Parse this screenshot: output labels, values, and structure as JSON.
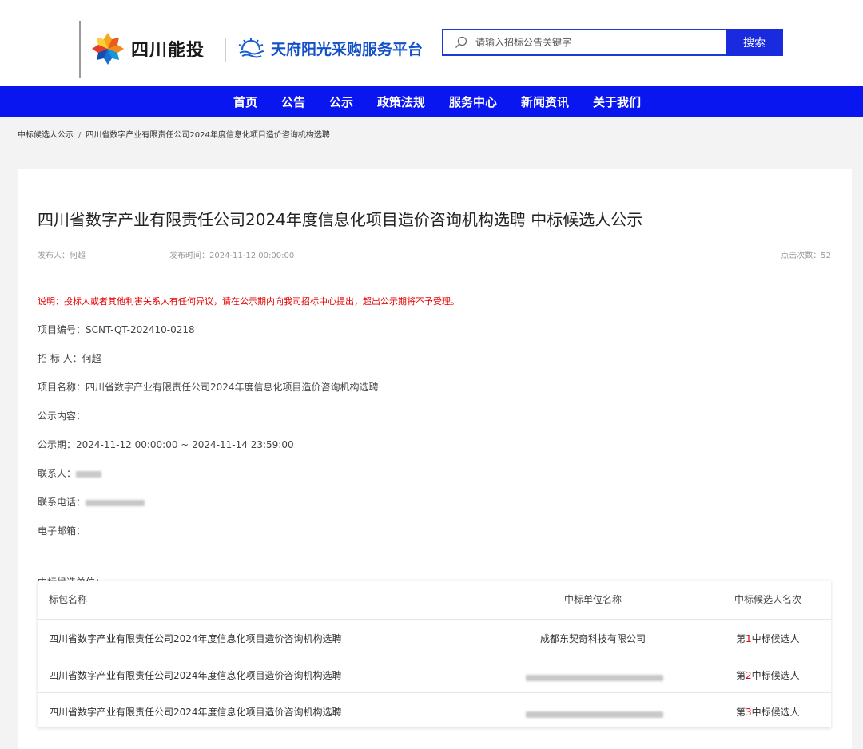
{
  "header": {
    "brand1": "四川能投",
    "brand2": "天府阳光采购服务平台",
    "search_placeholder": "请输入招标公告关键字",
    "search_button": "搜索"
  },
  "nav": [
    "首页",
    "公告",
    "公示",
    "政策法规",
    "服务中心",
    "新闻资讯",
    "关于我们"
  ],
  "breadcrumb": {
    "parent": "中标候选人公示",
    "separator": "/",
    "current": "四川省数字产业有限责任公司2024年度信息化项目造价咨询机构选聘"
  },
  "article": {
    "title": "四川省数字产业有限责任公司2024年度信息化项目造价咨询机构选聘 中标候选人公示",
    "publisher_label": "发布人：",
    "publisher": "何超",
    "publish_time_label": "发布时间：",
    "publish_time": "2024-11-12 00:00:00",
    "clicks_label": "点击次数：",
    "clicks": "52",
    "notice": "说明：投标人或者其他利害关系人有任何异议，请在公示期内向我司招标中心提出，超出公示期将不予受理。",
    "project_no_label": "项目编号：",
    "project_no": "SCNT-QT-202410-0218",
    "tenderer_label": "招 标 人：",
    "tenderer": "何超",
    "project_name_label": "项目名称：",
    "project_name": "四川省数字产业有限责任公司2024年度信息化项目造价咨询机构选聘",
    "content_label": "公示内容：",
    "period_label": "公示期：",
    "period": "2024-11-12 00:00:00 ~ 2024-11-14 23:59:00",
    "contact_label": "联系人：",
    "phone_label": "联系电话：",
    "email_label": "电子邮箱："
  },
  "candidates": {
    "section_label": "中标候选单位：",
    "headers": [
      "标包名称",
      "中标单位名称",
      "中标候选人名次"
    ],
    "rows": [
      {
        "package": "四川省数字产业有限责任公司2024年度信息化项目造价咨询机构选聘",
        "company": "成都东契奇科技有限公司",
        "rank_prefix": "第",
        "rank_num": "1",
        "rank_suffix": "中标候选人"
      },
      {
        "package": "四川省数字产业有限责任公司2024年度信息化项目造价咨询机构选聘",
        "company": "",
        "rank_prefix": "第",
        "rank_num": "2",
        "rank_suffix": "中标候选人"
      },
      {
        "package": "四川省数字产业有限责任公司2024年度信息化项目造价咨询机构选聘",
        "company": "",
        "rank_prefix": "第",
        "rank_num": "3",
        "rank_suffix": "中标候选人"
      }
    ]
  },
  "colors": {
    "nav_bg": "#0a16f0",
    "search_border": "#1a3bd6",
    "notice_red": "#e60000"
  }
}
